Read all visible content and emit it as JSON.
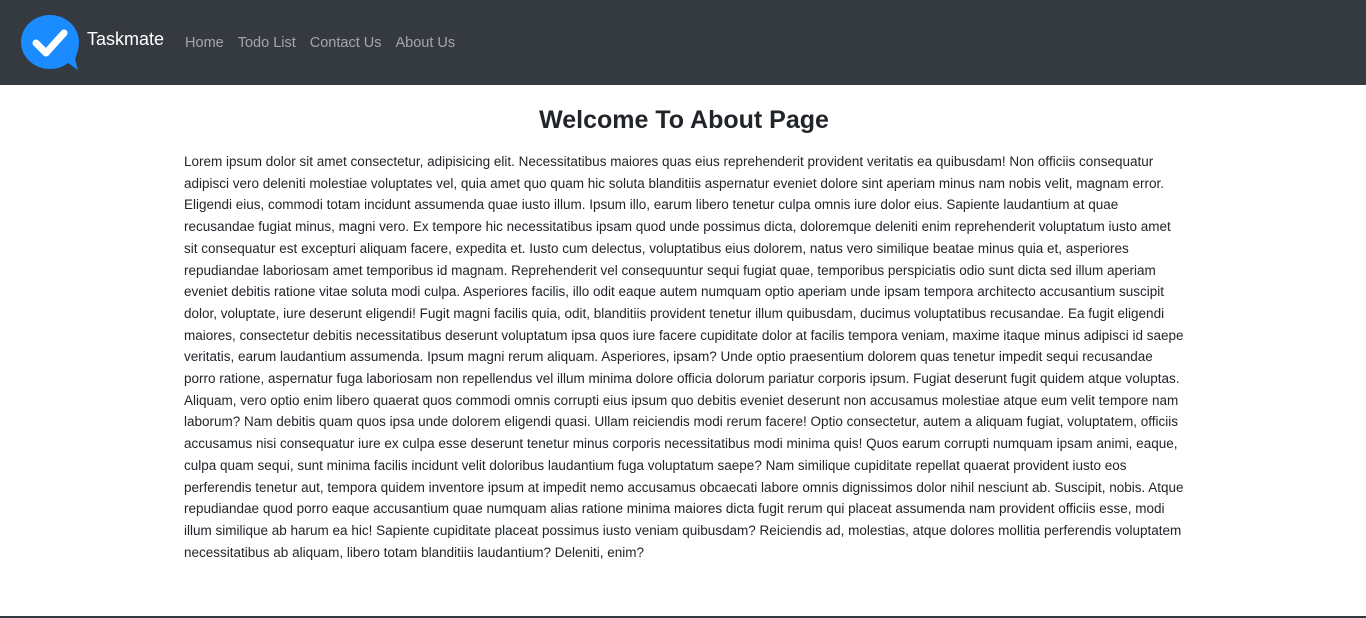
{
  "navbar": {
    "brand_name": "Taskmate",
    "logo_icon": "check-chat-bubble-icon",
    "links": [
      {
        "label": "Home"
      },
      {
        "label": "Todo List"
      },
      {
        "label": "Contact Us"
      },
      {
        "label": "About Us"
      }
    ]
  },
  "main": {
    "title": "Welcome To About Page",
    "paragraph": "Lorem ipsum dolor sit amet consectetur, adipisicing elit. Necessitatibus maiores quas eius reprehenderit provident veritatis ea quibusdam! Non officiis consequatur adipisci vero deleniti molestiae voluptates vel, quia amet quo quam hic soluta blanditiis aspernatur eveniet dolore sint aperiam minus nam nobis velit, magnam error. Eligendi eius, commodi totam incidunt assumenda quae iusto illum. Ipsum illo, earum libero tenetur culpa omnis iure dolor eius. Sapiente laudantium at quae recusandae fugiat minus, magni vero. Ex tempore hic necessitatibus ipsam quod unde possimus dicta, doloremque deleniti enim reprehenderit voluptatum iusto amet sit consequatur est excepturi aliquam facere, expedita et. Iusto cum delectus, voluptatibus eius dolorem, natus vero similique beatae minus quia et, asperiores repudiandae laboriosam amet temporibus id magnam. Reprehenderit vel consequuntur sequi fugiat quae, temporibus perspiciatis odio sunt dicta sed illum aperiam eveniet debitis ratione vitae soluta modi culpa. Asperiores facilis, illo odit eaque autem numquam optio aperiam unde ipsam tempora architecto accusantium suscipit dolor, voluptate, iure deserunt eligendi! Fugit magni facilis quia, odit, blanditiis provident tenetur illum quibusdam, ducimus voluptatibus recusandae. Ea fugit eligendi maiores, consectetur debitis necessitatibus deserunt voluptatum ipsa quos iure facere cupiditate dolor at facilis tempora veniam, maxime itaque minus adipisci id saepe veritatis, earum laudantium assumenda. Ipsum magni rerum aliquam. Asperiores, ipsam? Unde optio praesentium dolorem quas tenetur impedit sequi recusandae porro ratione, aspernatur fuga laboriosam non repellendus vel illum minima dolore officia dolorum pariatur corporis ipsum. Fugiat deserunt fugit quidem atque voluptas. Aliquam, vero optio enim libero quaerat quos commodi omnis corrupti eius ipsum quo debitis eveniet deserunt non accusamus molestiae atque eum velit tempore nam laborum? Nam debitis quam quos ipsa unde dolorem eligendi quasi. Ullam reiciendis modi rerum facere! Optio consectetur, autem a aliquam fugiat, voluptatem, officiis accusamus nisi consequatur iure ex culpa esse deserunt tenetur minus corporis necessitatibus modi minima quis! Quos earum corrupti numquam ipsam animi, eaque, culpa quam sequi, sunt minima facilis incidunt velit doloribus laudantium fuga voluptatum saepe? Nam similique cupiditate repellat quaerat provident iusto eos perferendis tenetur aut, tempora quidem inventore ipsum at impedit nemo accusamus obcaecati labore omnis dignissimos dolor nihil nesciunt ab. Suscipit, nobis. Atque repudiandae quod porro eaque accusantium quae numquam alias ratione minima maiores dicta fugit rerum qui placeat assumenda nam provident officiis esse, modi illum similique ab harum ea hic! Sapiente cupiditate placeat possimus iusto veniam quibusdam? Reiciendis ad, molestias, atque dolores mollitia perferendis voluptatem necessitatibus ab aliquam, libero totam blanditiis laudantium? Deleniti, enim?"
  },
  "colors": {
    "navbar_bg": "#343a40",
    "logo_blue": "#1a8cff",
    "text": "#212529",
    "nav_link": "rgba(255,255,255,0.55)"
  }
}
